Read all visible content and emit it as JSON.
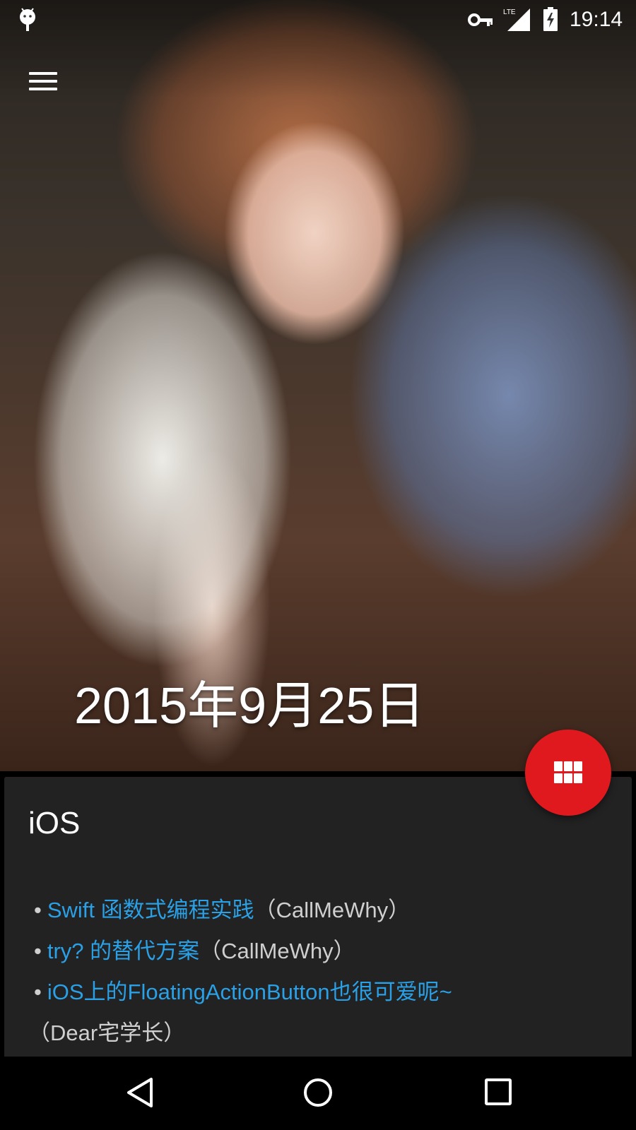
{
  "status_bar": {
    "time": "19:14",
    "network_label": "LTE",
    "icons": [
      "android-debug-icon",
      "vpn-key-icon",
      "lte-signal-icon",
      "battery-charging-icon"
    ]
  },
  "toolbar": {
    "menu_icon": "hamburger-menu-icon"
  },
  "hero": {
    "date": "2015年9月25日"
  },
  "fab": {
    "icon": "grid-apps-icon",
    "color": "#e0191f"
  },
  "card": {
    "category": "iOS",
    "items": [
      {
        "title": "Swift 函数式编程实践",
        "author": "（CallMeWhy）"
      },
      {
        "title": "try? 的替代方案",
        "author": "（CallMeWhy）"
      },
      {
        "title": "iOS上的FloatingActionButton也很可爱呢~",
        "author": "（Dear宅学长）"
      }
    ]
  },
  "nav_bar": {
    "icons": [
      "back-icon",
      "home-icon",
      "recents-icon"
    ]
  },
  "colors": {
    "link": "#2aa0e6",
    "card_background": "#222222",
    "accent": "#e0191f"
  }
}
